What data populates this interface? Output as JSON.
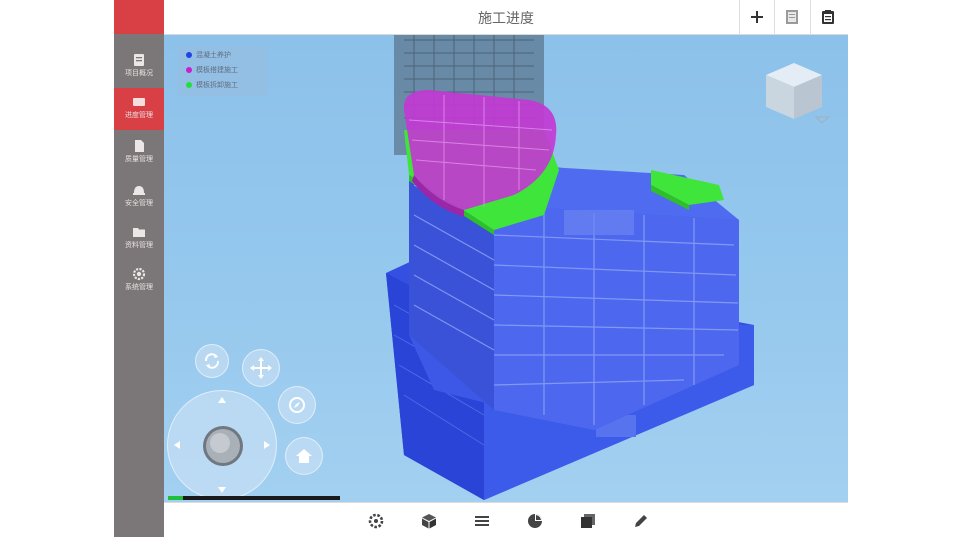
{
  "header": {
    "title": "施工进度"
  },
  "sidebar": {
    "items": [
      {
        "label": "项目概况",
        "icon": "doc-icon",
        "active": false
      },
      {
        "label": "进度管理",
        "icon": "card-icon",
        "active": true
      },
      {
        "label": "质量管理",
        "icon": "file-icon",
        "active": false
      },
      {
        "label": "安全管理",
        "icon": "helmet-icon",
        "active": false
      },
      {
        "label": "资料管理",
        "icon": "folder-icon",
        "active": false
      },
      {
        "label": "系统管理",
        "icon": "gear-icon",
        "active": false
      }
    ]
  },
  "legend": {
    "items": [
      {
        "label": "混凝土养护",
        "color": "#1e44e6"
      },
      {
        "label": "模板搭建施工",
        "color": "#c81ed0"
      },
      {
        "label": "模板拆卸施工",
        "color": "#22e03a"
      }
    ]
  },
  "progress": {
    "value": 0.09
  },
  "colors": {
    "accent": "#d84045",
    "sidebar": "#7b7677",
    "model_blue": "#2f4fe0",
    "model_magenta": "#c03ad0",
    "model_green": "#3ff03a"
  },
  "toolbar": {
    "icons": [
      "gear-icon",
      "cube-icon",
      "list-icon",
      "pie-chart-icon",
      "layers-icon",
      "pencil-icon"
    ]
  }
}
